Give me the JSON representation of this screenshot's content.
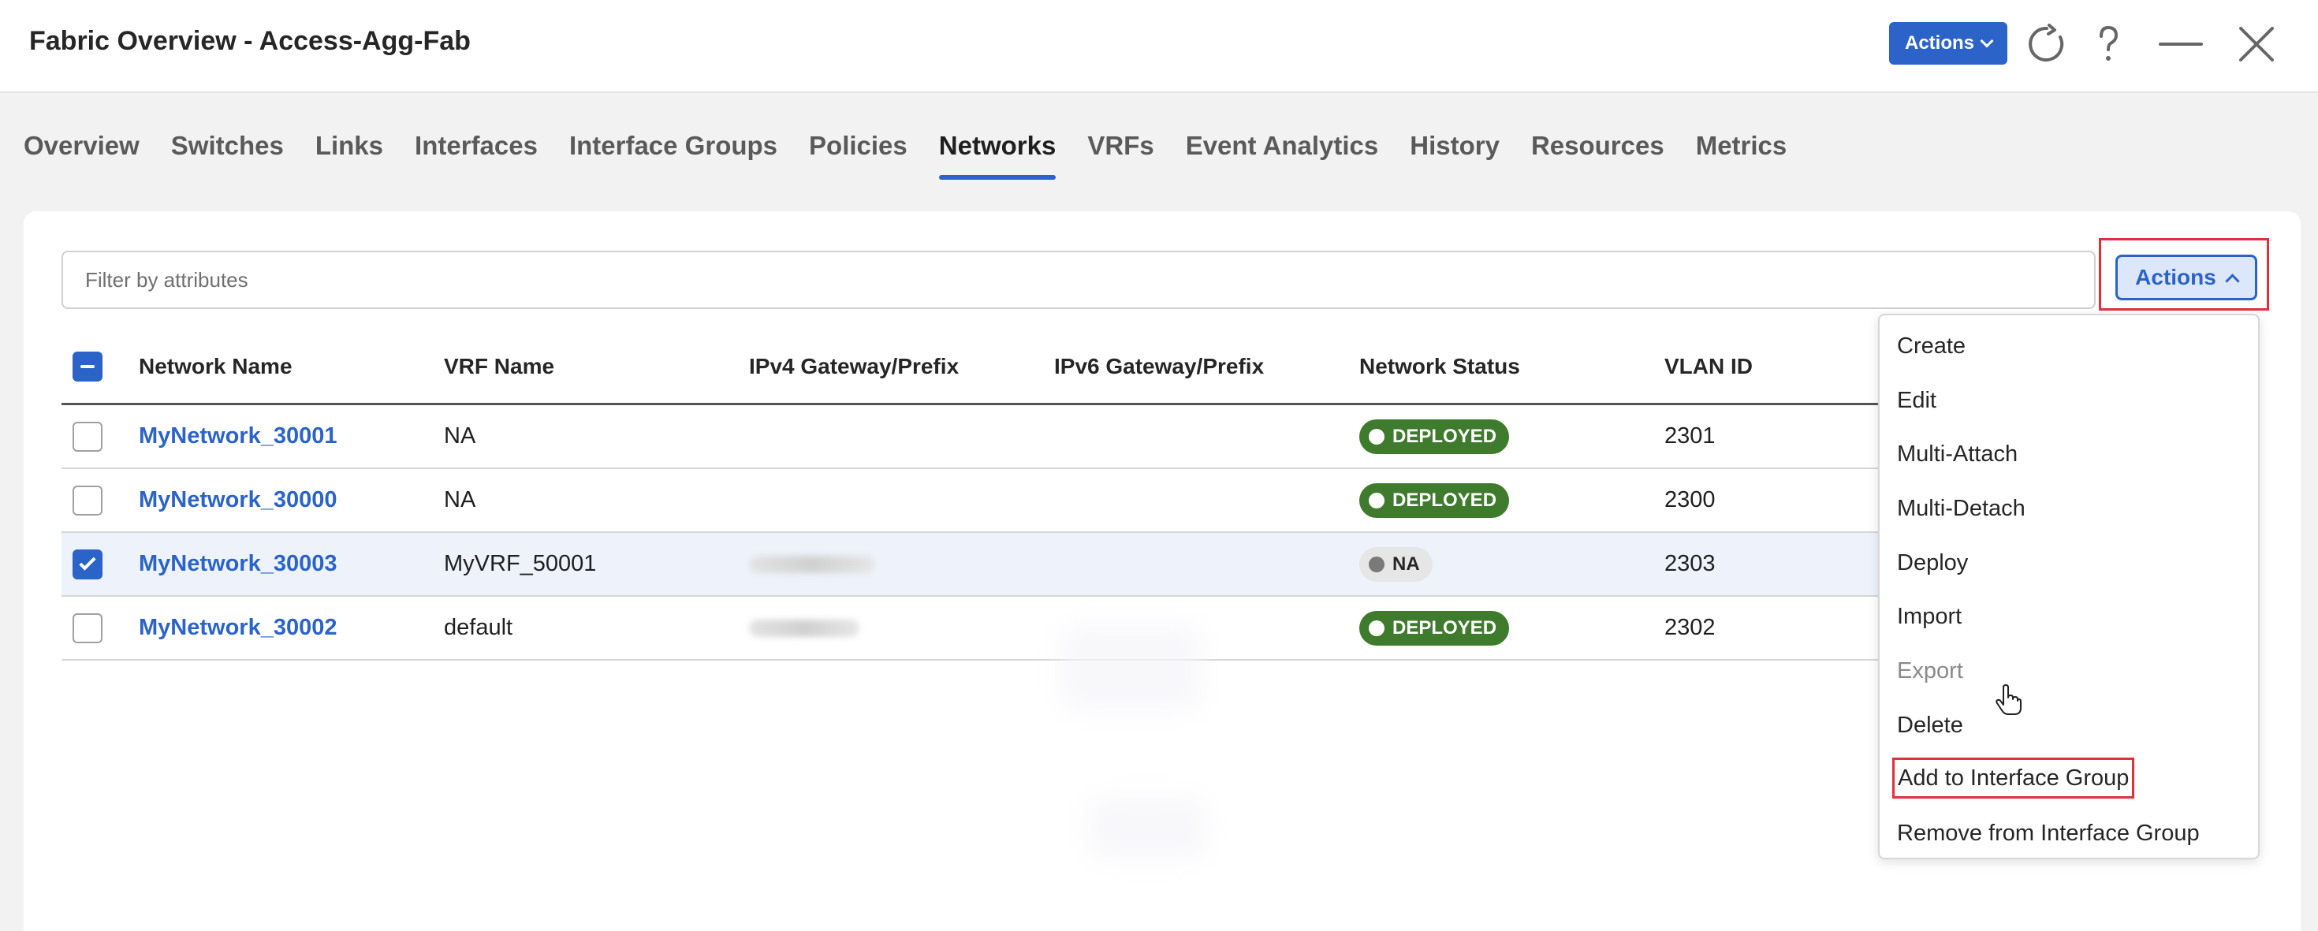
{
  "header": {
    "title": "Fabric Overview - Access-Agg-Fab",
    "actions_label": "Actions",
    "icons": [
      "refresh-icon",
      "help-icon",
      "minimize-icon",
      "close-icon"
    ]
  },
  "tabs": [
    {
      "label": "Overview",
      "active": false
    },
    {
      "label": "Switches",
      "active": false
    },
    {
      "label": "Links",
      "active": false
    },
    {
      "label": "Interfaces",
      "active": false
    },
    {
      "label": "Interface Groups",
      "active": false
    },
    {
      "label": "Policies",
      "active": false
    },
    {
      "label": "Networks",
      "active": true
    },
    {
      "label": "VRFs",
      "active": false
    },
    {
      "label": "Event Analytics",
      "active": false
    },
    {
      "label": "History",
      "active": false
    },
    {
      "label": "Resources",
      "active": false
    },
    {
      "label": "Metrics",
      "active": false
    }
  ],
  "filter": {
    "placeholder": "Filter by attributes"
  },
  "table_actions": {
    "label": "Actions"
  },
  "table": {
    "columns": [
      "Network Name",
      "VRF Name",
      "IPv4 Gateway/Prefix",
      "IPv6 Gateway/Prefix",
      "Network Status",
      "VLAN ID"
    ],
    "header_checkbox": "indeterminate",
    "rows": [
      {
        "name": "MyNetwork_30001",
        "vrf": "NA",
        "ipv4": "",
        "ipv6": "",
        "status": "DEPLOYED",
        "vlan": "2301",
        "checked": false
      },
      {
        "name": "MyNetwork_30000",
        "vrf": "NA",
        "ipv4": "",
        "ipv6": "",
        "status": "DEPLOYED",
        "vlan": "2300",
        "checked": false
      },
      {
        "name": "MyNetwork_30003",
        "vrf": "MyVRF_50001",
        "ipv4": "",
        "ipv6": "",
        "status": "NA",
        "vlan": "2303",
        "checked": true
      },
      {
        "name": "MyNetwork_30002",
        "vrf": "default",
        "ipv4": "",
        "ipv6": "",
        "status": "DEPLOYED",
        "vlan": "2302",
        "checked": false
      }
    ]
  },
  "menu": {
    "items": [
      {
        "label": "Create",
        "disabled": false
      },
      {
        "label": "Edit",
        "disabled": false
      },
      {
        "label": "Multi-Attach",
        "disabled": false
      },
      {
        "label": "Multi-Detach",
        "disabled": false
      },
      {
        "label": "Deploy",
        "disabled": false
      },
      {
        "label": "Import",
        "disabled": false
      },
      {
        "label": "Export",
        "disabled": true
      },
      {
        "label": "Delete",
        "disabled": false
      },
      {
        "label": "Add to Interface Group",
        "disabled": false
      },
      {
        "label": "Remove from Interface Group",
        "disabled": false
      }
    ]
  },
  "colors": {
    "accent": "#2b63c9",
    "deployed": "#3f7b2d",
    "highlight_border": "#e0303a"
  }
}
